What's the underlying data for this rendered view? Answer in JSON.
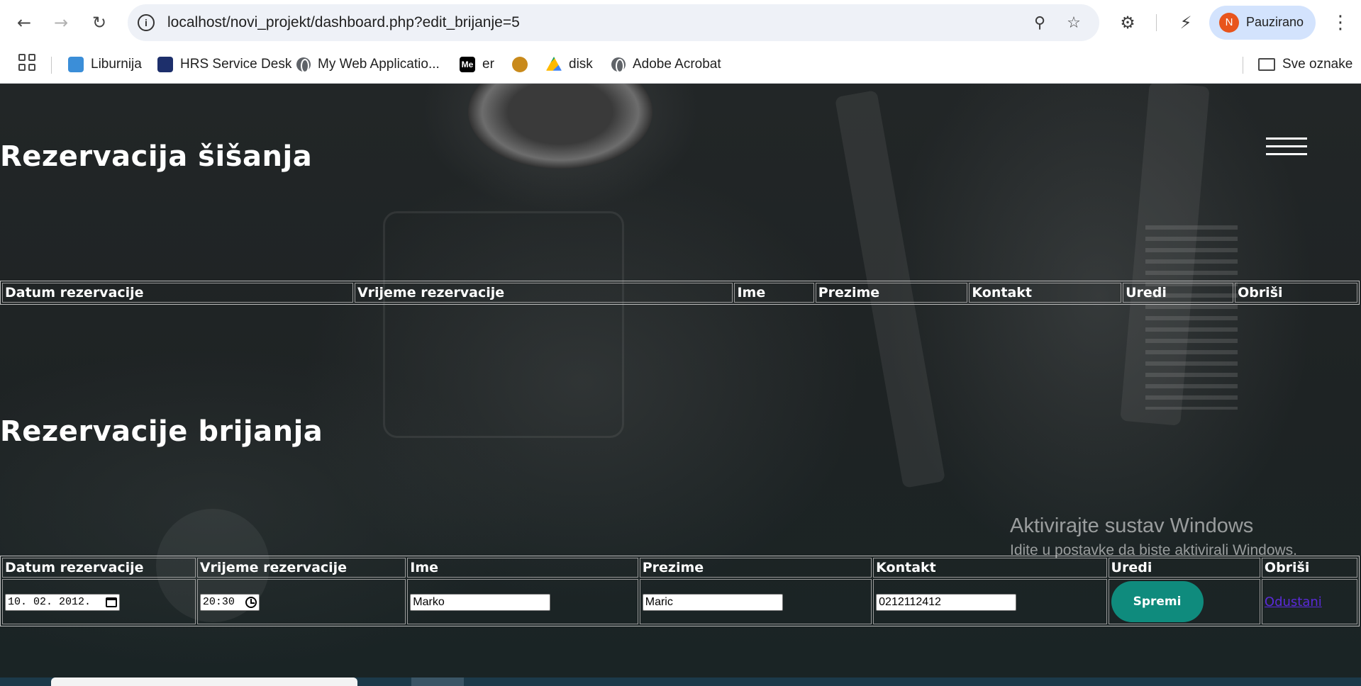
{
  "browser": {
    "url": "localhost/novi_projekt/dashboard.php?edit_brijanje=5",
    "profile_initial": "N",
    "profile_label": "Pauzirano",
    "bookmarks": [
      {
        "label": "Liburnija"
      },
      {
        "label": "HRS Service Desk"
      },
      {
        "label": "My Web Applicatio..."
      },
      {
        "label": "er",
        "icon_text": "Me"
      },
      {
        "label": ""
      },
      {
        "label": "disk"
      },
      {
        "label": "Adobe Acrobat"
      }
    ],
    "all_bookmarks_label": "Sve oznake"
  },
  "page": {
    "haircut_section": {
      "title": "Rezervacija šišanja",
      "columns": [
        "Datum rezervacije",
        "Vrijeme rezervacije",
        "Ime",
        "Prezime",
        "Kontakt",
        "Uredi",
        "Obriši"
      ]
    },
    "shave_section": {
      "title": "Rezervacije brijanja",
      "columns": [
        "Datum rezervacije",
        "Vrijeme rezervacije",
        "Ime",
        "Prezime",
        "Kontakt",
        "Uredi",
        "Obriši"
      ],
      "edit_row": {
        "date_value": "10. 02. 2012.",
        "time_value": "20:30",
        "first_name": "Marko",
        "last_name": "Maric",
        "contact": "0212112412",
        "save_label": "Spremi",
        "cancel_label": "Odustani"
      }
    }
  },
  "windows_watermark": {
    "line1": "Aktivirajte sustav Windows",
    "line2": "Idite u postavke da biste aktivirali Windows."
  },
  "colors": {
    "save_button": "#0f8b7d",
    "cancel_link": "#5a2bd8",
    "profile_avatar": "#e8541c"
  }
}
